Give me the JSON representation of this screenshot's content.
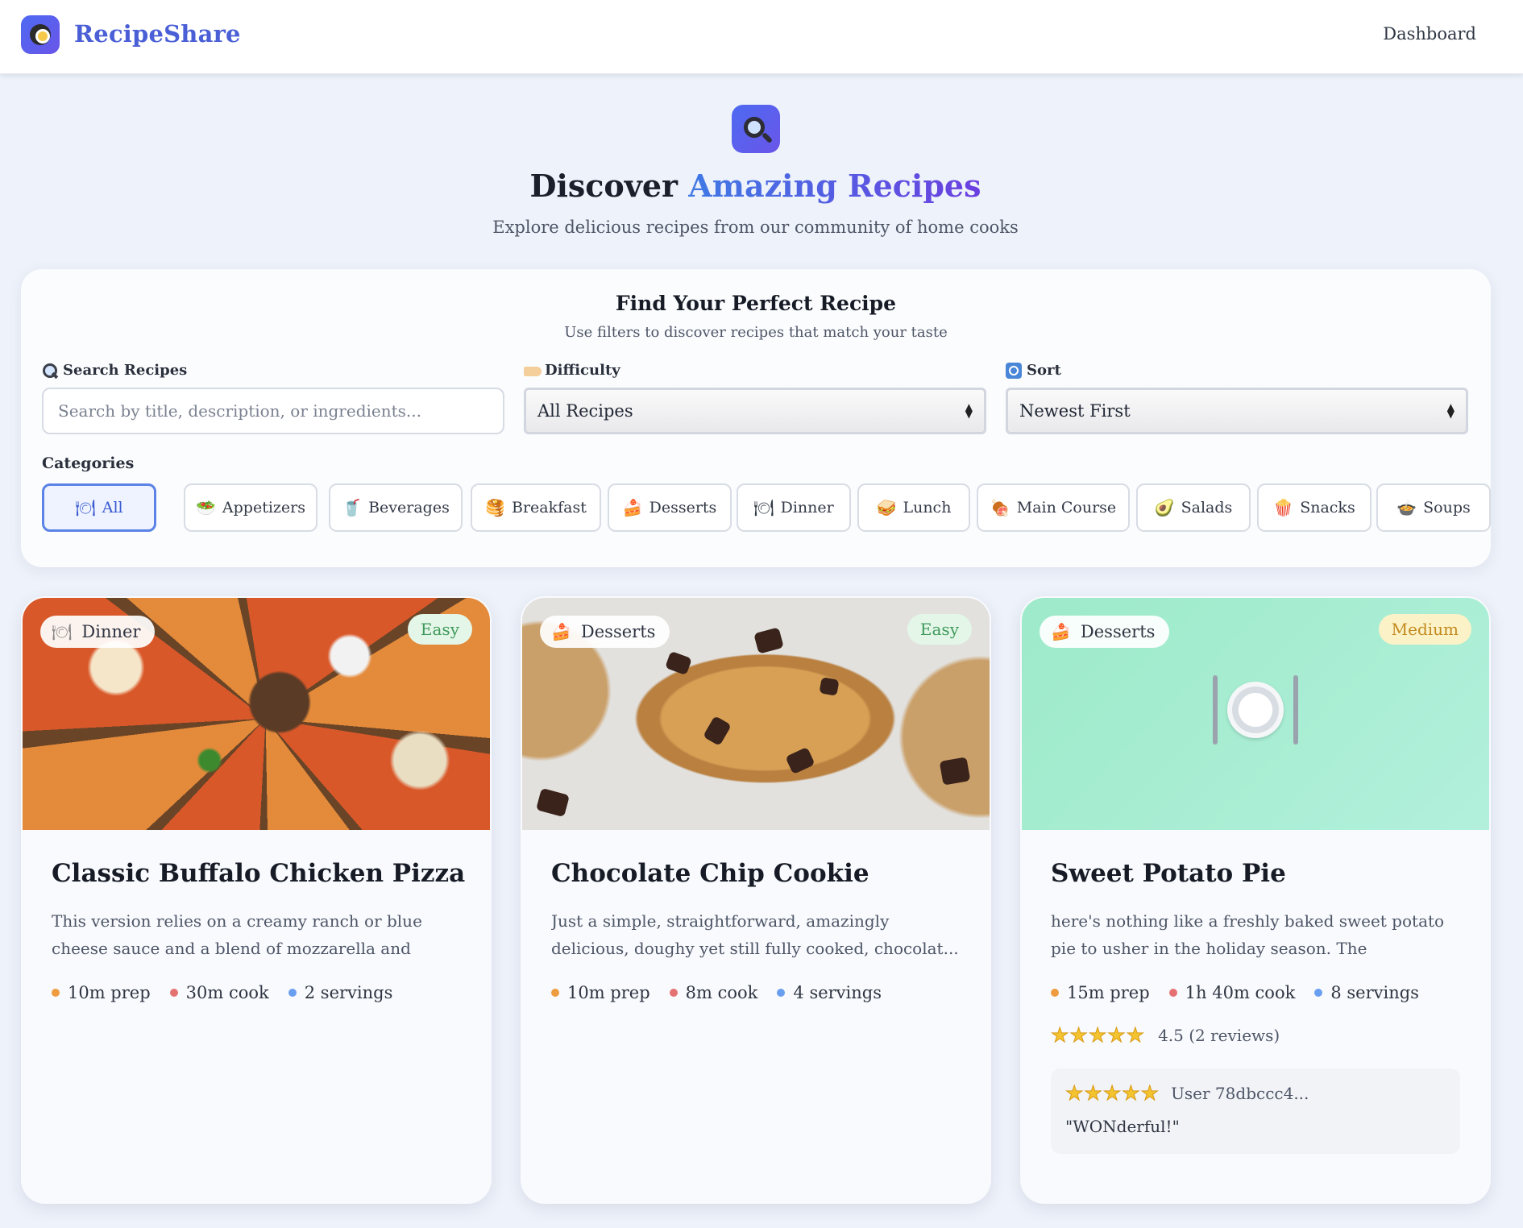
{
  "nav": {
    "brand": "RecipeShare",
    "dashboard": "Dashboard"
  },
  "hero": {
    "title_prefix": "Discover",
    "title_highlight": "Amazing Recipes",
    "subtitle": "Explore delicious recipes from our community of home cooks"
  },
  "filters": {
    "title": "Find Your Perfect Recipe",
    "subtitle": "Use filters to discover recipes that match your taste",
    "search_label": "Search Recipes",
    "search_placeholder": "Search by title, description, or ingredients...",
    "difficulty_label": "Difficulty",
    "difficulty_value": "All Recipes",
    "sort_label": "Sort",
    "sort_value": "Newest First",
    "categories_label": "Categories",
    "categories": [
      {
        "label": "All",
        "icon": "plate-icon",
        "glyph": "🍽",
        "active": true
      },
      {
        "label": "Appetizers",
        "icon": "appetizer-icon",
        "glyph": "🥗",
        "active": false
      },
      {
        "label": "Beverages",
        "icon": "drink-icon",
        "glyph": "🥤",
        "active": false
      },
      {
        "label": "Breakfast",
        "icon": "pancake-icon",
        "glyph": "🥞",
        "active": false
      },
      {
        "label": "Desserts",
        "icon": "cake-icon",
        "glyph": "🍰",
        "active": false
      },
      {
        "label": "Dinner",
        "icon": "plate-icon",
        "glyph": "🍽",
        "active": false
      },
      {
        "label": "Lunch",
        "icon": "sandwich-icon",
        "glyph": "🥪",
        "active": false
      },
      {
        "label": "Main Course",
        "icon": "meat-icon",
        "glyph": "🍖",
        "active": false
      },
      {
        "label": "Salads",
        "icon": "salad-icon",
        "glyph": "🥑",
        "active": false
      },
      {
        "label": "Snacks",
        "icon": "popcorn-icon",
        "glyph": "🍿",
        "active": false
      },
      {
        "label": "Soups",
        "icon": "soup-icon",
        "glyph": "🍲",
        "active": false
      }
    ]
  },
  "recipes": [
    {
      "category": "Dinner",
      "category_glyph": "🍽",
      "difficulty": "Easy",
      "title": "Classic Buffalo Chicken Pizza",
      "description": "This version relies on a creamy ranch or blue cheese sauce and a blend of mozzarella and blue...",
      "prep": "10m prep",
      "cook": "30m cook",
      "servings": "2 servings"
    },
    {
      "category": "Desserts",
      "category_glyph": "🍰",
      "difficulty": "Easy",
      "title": "Chocolate Chip Cookie",
      "description": "Just a simple, straightforward, amazingly delicious, doughy yet still fully cooked, chocolat...",
      "prep": "10m prep",
      "cook": "8m cook",
      "servings": "4 servings"
    },
    {
      "category": "Desserts",
      "category_glyph": "🍰",
      "difficulty": "Medium",
      "title": "Sweet Potato Pie",
      "description": "here's nothing like a freshly baked sweet potato pie to usher in the holiday season. The autumnal...",
      "prep": "15m prep",
      "cook": "1h 40m cook",
      "servings": "8 servings",
      "rating_stars": "★★★★★",
      "rating_text": "4.5 (2 reviews)",
      "review_stars": "★★★★★",
      "review_user": "User 78dbccc4...",
      "review_text": "\"WONderful!\""
    }
  ],
  "colors": {
    "brand": "#4a5fd6",
    "accent_gradient_start": "#3f7ae4",
    "accent_gradient_end": "#6b3fe0",
    "easy": "#3f9a5a",
    "medium": "#c28a1f"
  }
}
